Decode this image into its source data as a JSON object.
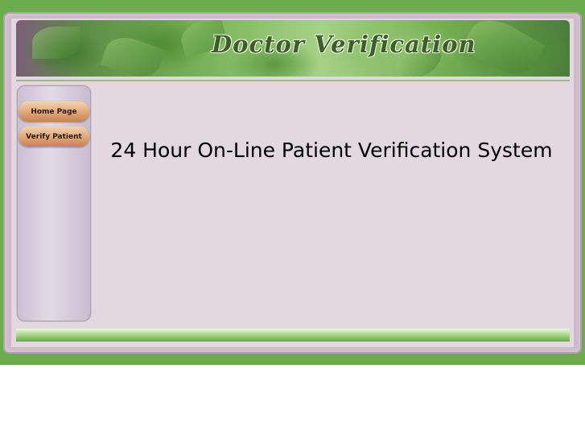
{
  "banner": {
    "title": "Doctor Verification"
  },
  "nav": {
    "items": [
      {
        "label": "Home Page"
      },
      {
        "label": "Verify Patient"
      }
    ]
  },
  "main": {
    "heading": "24 Hour On-Line Patient Verification System"
  },
  "colors": {
    "outer_green": "#6aad4c",
    "frame": "#cdb9c9",
    "content_bg": "#e2d8e0",
    "button_orange": "#e0a574"
  }
}
